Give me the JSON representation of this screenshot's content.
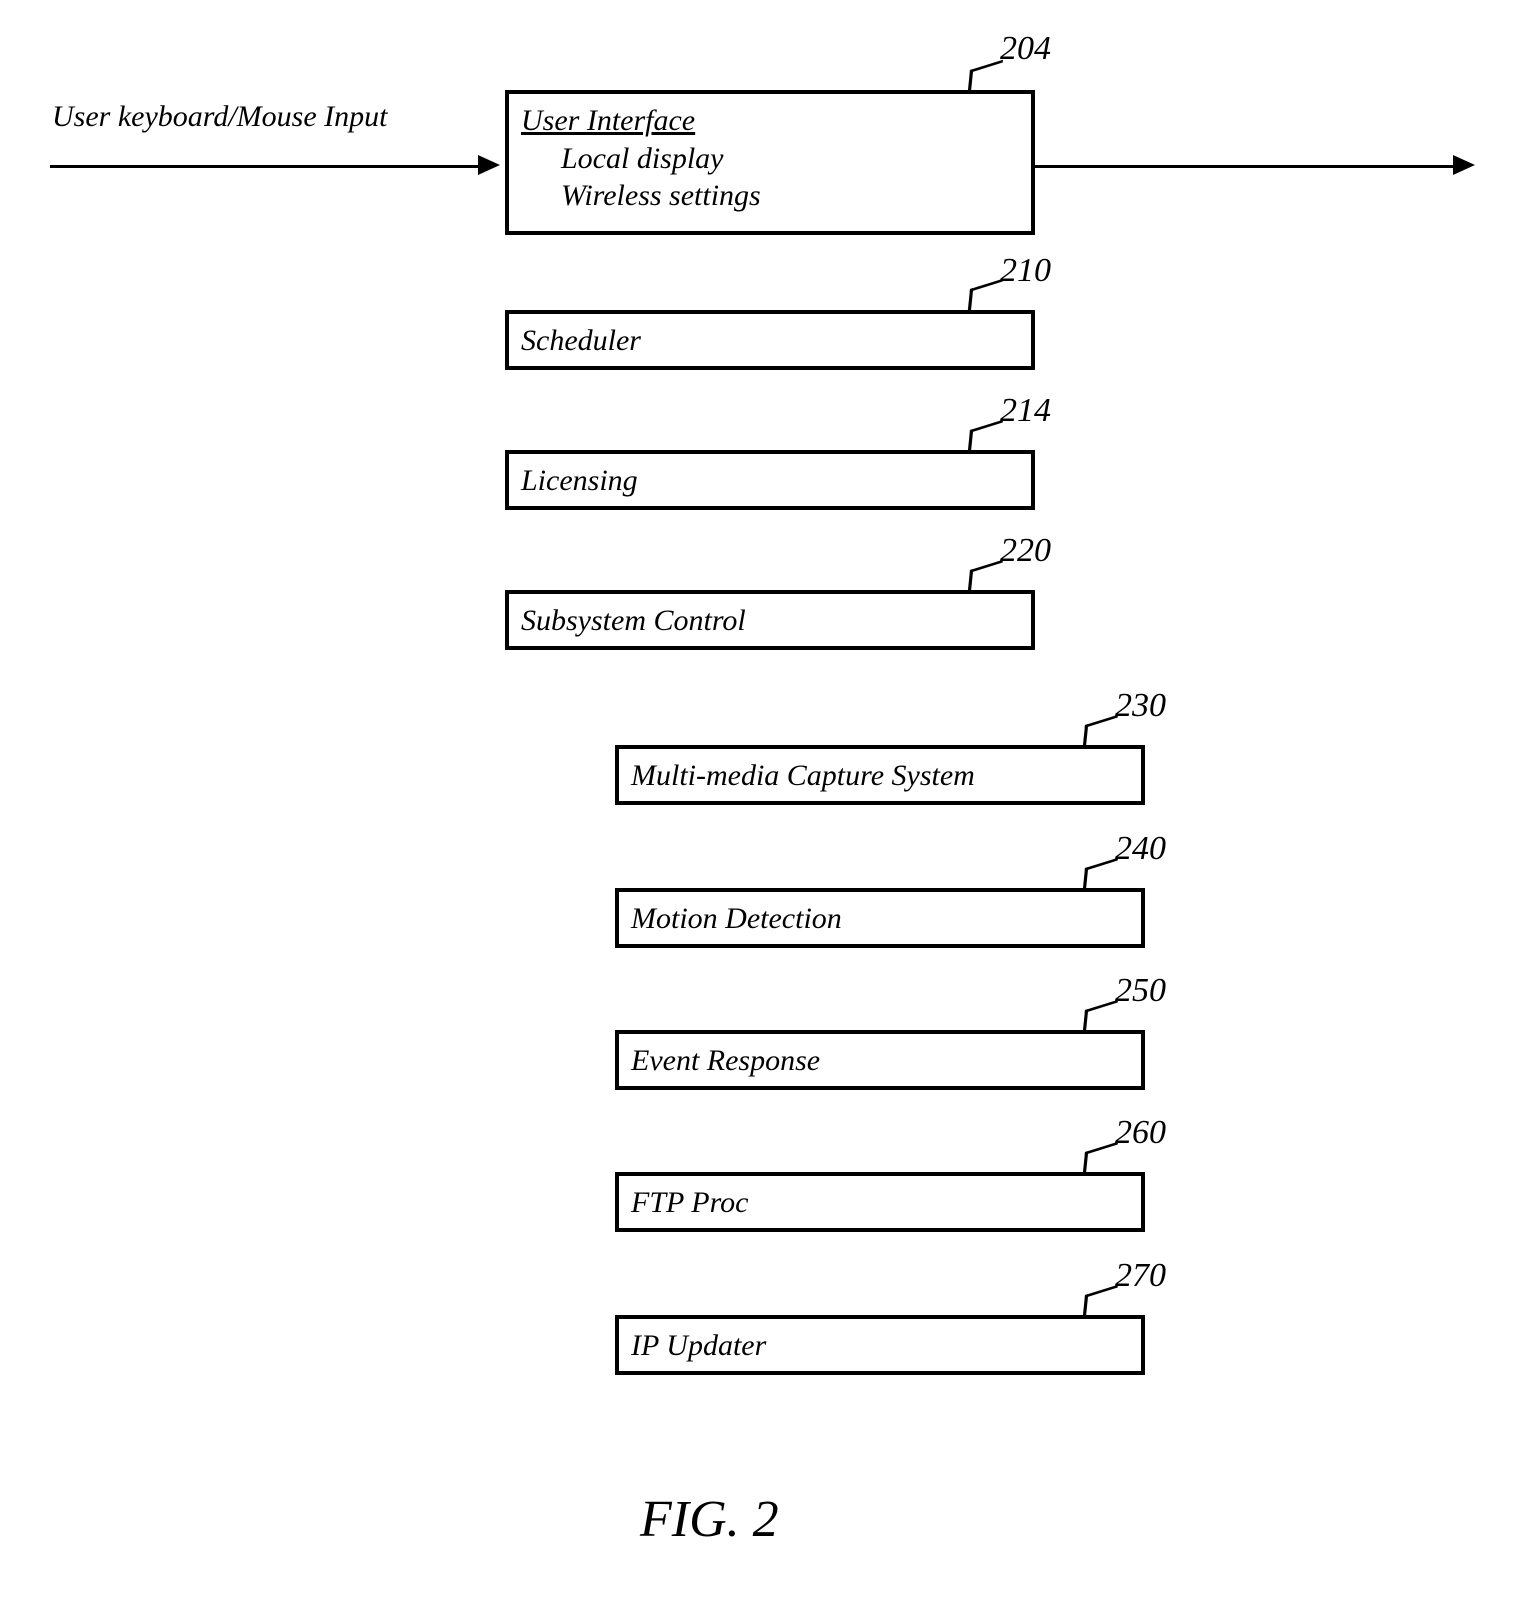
{
  "input_label": "User keyboard/Mouse Input",
  "blocks": {
    "b204": {
      "ref": "204",
      "title": "User Interface",
      "sub1": "Local display",
      "sub2": "Wireless settings"
    },
    "b210": {
      "ref": "210",
      "title": "Scheduler"
    },
    "b214": {
      "ref": "214",
      "title": "Licensing"
    },
    "b220": {
      "ref": "220",
      "title": "Subsystem Control"
    },
    "b230": {
      "ref": "230",
      "title": "Multi-media Capture System"
    },
    "b240": {
      "ref": "240",
      "title": "Motion Detection"
    },
    "b250": {
      "ref": "250",
      "title": "Event Response"
    },
    "b260": {
      "ref": "260",
      "title": "FTP Proc"
    },
    "b270": {
      "ref": "270",
      "title": "IP Updater"
    }
  },
  "figure_label": "FIG. 2"
}
